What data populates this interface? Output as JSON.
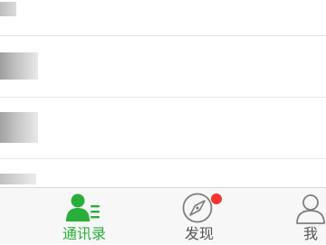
{
  "contact_list": {
    "rows": [
      {
        "name": "",
        "state": "blurred"
      },
      {
        "name": "",
        "state": "blurred"
      },
      {
        "name": "",
        "state": "blurred"
      },
      {
        "name": "",
        "state": "blurred"
      }
    ]
  },
  "tab_bar": {
    "tabs": [
      {
        "id": "contacts",
        "label": "通讯录",
        "icon": "contacts-icon",
        "active": true
      },
      {
        "id": "discover",
        "label": "发现",
        "icon": "compass-icon",
        "active": false,
        "badge": "dot"
      },
      {
        "id": "me",
        "label": "我",
        "icon": "person-icon",
        "active": false
      }
    ]
  },
  "colors": {
    "accent": "#2aae3b",
    "badge": "#f43530",
    "inactive_icon": "#7f7f7f",
    "tabbar_bg": "#f7f7f7",
    "divider": "#e4e4e4"
  }
}
